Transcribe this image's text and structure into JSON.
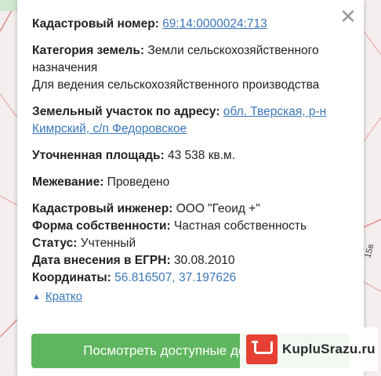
{
  "popup": {
    "close_symbol": "✕",
    "cadastral_number": {
      "label": "Кадастровый номер:",
      "value": "69:14:0000024:713"
    },
    "land_category": {
      "label": "Категория земель:",
      "value": "Земли сельскохозяйственного назначения",
      "usage": "Для ведения сельскохозяйственного производства"
    },
    "address": {
      "label": "Земельный участок по адресу:",
      "value": "обл. Тверская, р-н Кимрский, с/п Федоровское"
    },
    "area": {
      "label": "Уточненная площадь:",
      "value": "43 538 кв.м."
    },
    "survey": {
      "label": "Межевание:",
      "value": "Проведено"
    },
    "engineer": {
      "label": "Кадастровый инженер:",
      "value": "ООО \"Геоид +\""
    },
    "ownership": {
      "label": "Форма собственности:",
      "value": "Частная собственность"
    },
    "status": {
      "label": "Статус:",
      "value": "Учтенный"
    },
    "egrn_date": {
      "label": "Дата внесения в ЕГРН:",
      "value": "30.08.2010"
    },
    "coordinates": {
      "label": "Координаты:",
      "value": "56.816507, 37.197626"
    },
    "toggle": {
      "icon": "▲",
      "label": "Кратко"
    },
    "button_label": "Посмотреть доступные документы"
  },
  "map": {
    "label_right": "15в"
  },
  "watermark": {
    "text": "KupluSrazu.ru"
  },
  "colors": {
    "link": "#3a76b8",
    "button": "#5fb65f",
    "watermark_logo": "#e64034"
  }
}
